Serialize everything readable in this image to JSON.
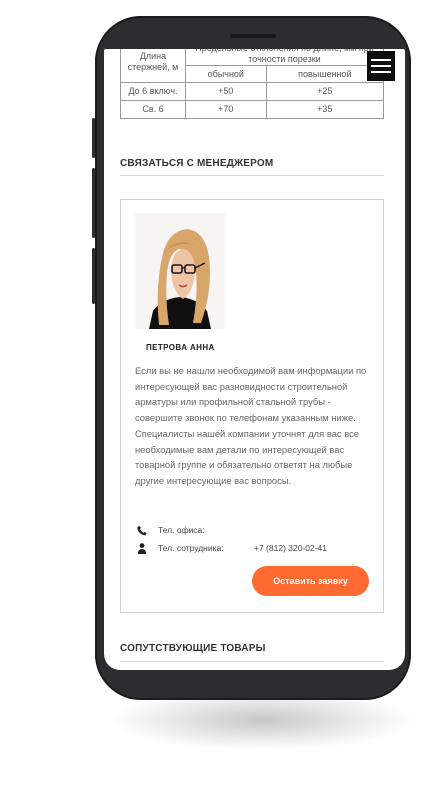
{
  "spec_table": {
    "length_header": "Длина стержней, м",
    "deviation_header": "Предельные отклонения по длине, мм при точности порезки",
    "col_normal": "обычной",
    "col_high": "повышенной",
    "rows": [
      {
        "length": "До 6 включ.",
        "normal": "+50",
        "high": "+25"
      },
      {
        "length": "Св. 6",
        "normal": "+70",
        "high": "+35"
      }
    ]
  },
  "contact_section": {
    "title": "СВЯЗАТЬСЯ С МЕНЕДЖЕРОМ",
    "manager_name": "ПЕТРОВА АННА",
    "description": "Если вы не нашли необходимой вам информации по интересующей вас разновидности строительной арматуры или профильной стальной трубы - совершите звонок по телефонам указанным ниже. Специалисты нашей компании уточнят для вас все необходимые вам детали по интересующей вас товарной группе и обязательно ответят на любые другие интересующие вас вопросы.",
    "office_phone_label": "Тел. офиса:",
    "office_phone_value": "",
    "staff_phone_label": "Тел. сотрудника:",
    "staff_phone_value": "+7 (812) 320-02-41",
    "cta_label": "Оставить заявку"
  },
  "related_section": {
    "title": "СОПУТСТВУЮЩИЕ ТОВАРЫ"
  },
  "icons": {
    "menu": "hamburger-menu-icon",
    "phone": "phone-icon",
    "person": "person-icon"
  },
  "colors": {
    "accent": "#ff6a30",
    "menu_button": "#0d0d0d",
    "phone_frame": "#2b2d2f"
  }
}
